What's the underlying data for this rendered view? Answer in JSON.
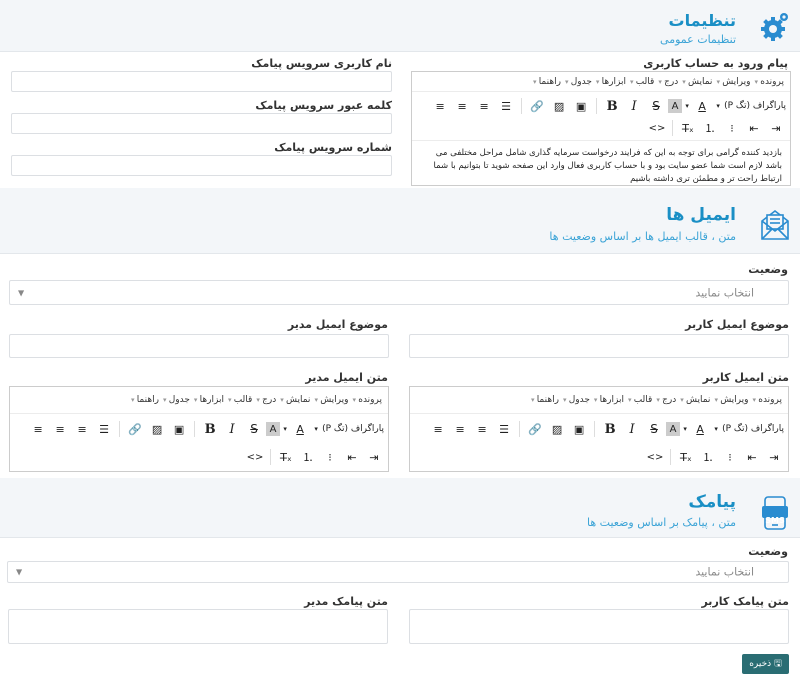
{
  "settings": {
    "title": "تنظیمات",
    "subtitle": "تنظیمات عمومی",
    "welcome_label": "پیام ورود به حساب کاربری",
    "sms_user_label": "نام کاربری سرویس پیامک",
    "sms_pass_label": "کلمه عبور سرویس پیامک",
    "sms_number_label": "شماره سرویس پیامک",
    "welcome_text": "بازدید کننده گرامی برای توجه به این که فرایند درخواست سرمایه گذاری شامل مراحل مختلفی می باشد لازم است شما عضو سایت بود و با حساب کاربری فعال وارد این صفحه شوید تا بتوانیم با شما ارتباط راحت تر و مطمئن تری داشته باشیم"
  },
  "editor": {
    "menus": [
      "پرونده",
      "ویرایش",
      "نمایش",
      "درج",
      "قالب",
      "ابزارها",
      "جدول",
      "راهنما"
    ],
    "format_label": "پاراگراف (تگ P)",
    "code_label": "<>"
  },
  "emails": {
    "title": "ایمیل ها",
    "subtitle": "متن ، قالب ایمیل ها بر اساس وضعیت ها",
    "status_label": "وضعیت",
    "status_placeholder": "انتخاب نمایید",
    "user_subject_label": "موضوع ایمیل کاربر",
    "admin_subject_label": "موضوع ایمیل مدیر",
    "user_text_label": "متن ایمیل کاربر",
    "admin_text_label": "متن ایمیل مدیر"
  },
  "sms": {
    "title": "پیامک",
    "subtitle": "متن ، پیامک بر اساس وضعیت ها",
    "status_label": "وضعیت",
    "status_placeholder": "انتخاب نمایید",
    "user_text_label": "متن پیامک کاربر",
    "admin_text_label": "متن پیامک مدیر",
    "icon_text": "SMS"
  },
  "save_label": "ذخیره",
  "colors": {
    "accent": "#1a8fc5",
    "save": "#2a6d73",
    "header_bg": "#f3f6f9"
  }
}
